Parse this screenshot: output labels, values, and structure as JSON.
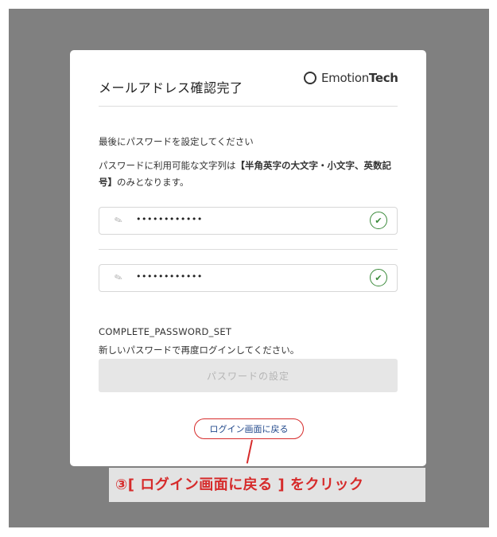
{
  "dialog": {
    "title": "メールアドレス確認完了",
    "logo_light": "Emotion",
    "logo_bold": "Tech",
    "instruction": "最後にパスワードを設定してください",
    "rule_prefix": "パスワードに利用可能な文字列は",
    "rule_bold": "【半角英字の大文字・小文字、英数記号】",
    "rule_suffix": "のみとなります。",
    "password_value": "••••••••••••",
    "confirm_value": "••••••••••••",
    "password_icon": "pencil-icon",
    "valid_icon": "check-circle-icon",
    "status_code": "COMPLETE_PASSWORD_SET",
    "status_message": "新しいパスワードで再度ログインしてください。",
    "submit_label": "パスワードの設定",
    "back_link": "ログイン画面に戻る"
  },
  "annotation": {
    "text": "③[ ログイン画面に戻る ] をクリック",
    "color": "#d62b2b"
  },
  "colors": {
    "backdrop": "#808080",
    "valid": "#3a8a3a",
    "link": "#234a8c"
  }
}
